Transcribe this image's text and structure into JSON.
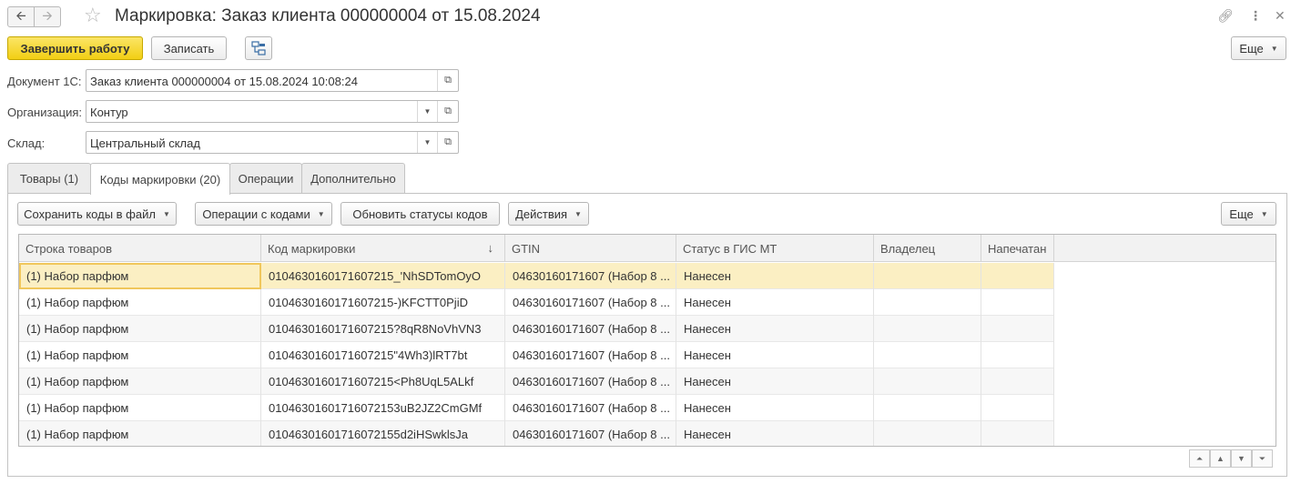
{
  "window": {
    "title": "Маркировка: Заказ клиента 000000004 от 15.08.2024",
    "back_icon": "arrow-left-icon",
    "forward_icon": "arrow-right-icon",
    "favorite_icon": "star-icon",
    "link_icon": "link-icon",
    "more_icon": "kebab-icon",
    "close_icon": "close-icon"
  },
  "toolbar": {
    "finish_label": "Завершить работу",
    "save_label": "Записать",
    "more_label": "Еще"
  },
  "fields": {
    "document": {
      "label": "Документ 1С:",
      "value": "Заказ клиента 000000004 от 15.08.2024 10:08:24"
    },
    "organization": {
      "label": "Организация:",
      "value": "Контур"
    },
    "warehouse": {
      "label": "Склад:",
      "value": "Центральный склад"
    }
  },
  "tabs": [
    {
      "label": "Товары (1)"
    },
    {
      "label": "Коды маркировки (20)"
    },
    {
      "label": "Операции"
    },
    {
      "label": "Дополнительно"
    }
  ],
  "panel_toolbar": {
    "save_codes_label": "Сохранить коды в файл",
    "code_ops_label": "Операции с кодами",
    "refresh_status_label": "Обновить статусы кодов",
    "actions_label": "Действия",
    "more_label": "Еще"
  },
  "table": {
    "columns": [
      "Строка товаров",
      "Код маркировки",
      "GTIN",
      "Статус в ГИС МТ",
      "Владелец",
      "Напечатан"
    ],
    "sort_icon": "↓",
    "rows": [
      [
        "(1) Набор парфюм",
        "0104630160171607215_'NhSDTomOyO",
        "04630160171607 (Набор 8 ...",
        "Нанесен",
        "",
        ""
      ],
      [
        "(1) Набор парфюм",
        "0104630160171607215-)KFCTT0PjiD",
        "04630160171607 (Набор 8 ...",
        "Нанесен",
        "",
        ""
      ],
      [
        "(1) Набор парфюм",
        "0104630160171607215?8qR8NoVhVN3",
        "04630160171607 (Набор 8 ...",
        "Нанесен",
        "",
        ""
      ],
      [
        "(1) Набор парфюм",
        "0104630160171607215\"4Wh3)lRT7bt",
        "04630160171607 (Набор 8 ...",
        "Нанесен",
        "",
        ""
      ],
      [
        "(1) Набор парфюм",
        "0104630160171607215<Ph8UqL5ALkf",
        "04630160171607 (Набор 8 ...",
        "Нанесен",
        "",
        ""
      ],
      [
        "(1) Набор парфюм",
        "01046301601716072153uB2JZ2CmGMf",
        "04630160171607 (Набор 8 ...",
        "Нанесен",
        "",
        ""
      ],
      [
        "(1) Набор парфюм",
        "01046301601716072155d2iHSwklsJa",
        "04630160171607 (Набор 8 ...",
        "Нанесен",
        "",
        ""
      ]
    ]
  }
}
